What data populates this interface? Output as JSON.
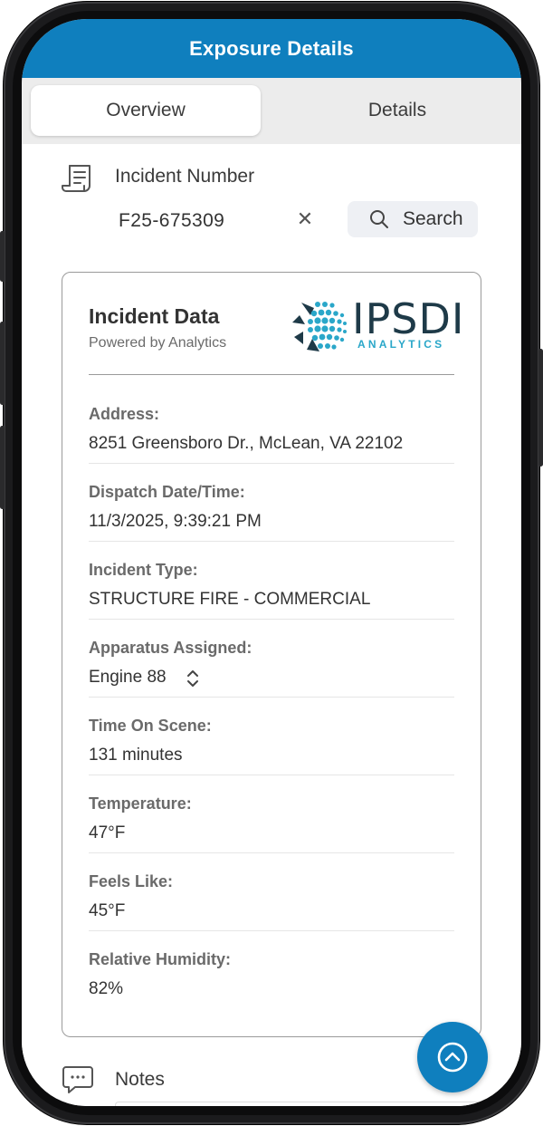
{
  "app": {
    "title": "Exposure Details"
  },
  "tabs": [
    {
      "label": "Overview",
      "active": true
    },
    {
      "label": "Details",
      "active": false
    }
  ],
  "incident": {
    "label": "Incident Number",
    "value": "F25-675309",
    "search_label": "Search"
  },
  "card": {
    "title": "Incident Data",
    "subtitle": "Powered by Analytics",
    "logo_text": "IPSDI",
    "logo_subtext": "ANALYTICS",
    "fields": [
      {
        "label": "Address:",
        "value": "8251 Greensboro Dr., McLean, VA 22102"
      },
      {
        "label": "Dispatch Date/Time:",
        "value": "11/3/2025, 9:39:21 PM"
      },
      {
        "label": "Incident Type:",
        "value": "STRUCTURE FIRE - COMMERCIAL"
      },
      {
        "label": "Apparatus Assigned:",
        "value": "Engine 88"
      },
      {
        "label": "Time On Scene:",
        "value": "131 minutes"
      },
      {
        "label": "Temperature:",
        "value": "47°F"
      },
      {
        "label": "Feels Like:",
        "value": "45°F"
      },
      {
        "label": "Relative Humidity:",
        "value": "82%"
      }
    ]
  },
  "notes": {
    "label": "Notes"
  },
  "colors": {
    "accent": "#0f7fbe",
    "logo_dark": "#1e3a48",
    "logo_teal": "#2aa7c9"
  }
}
